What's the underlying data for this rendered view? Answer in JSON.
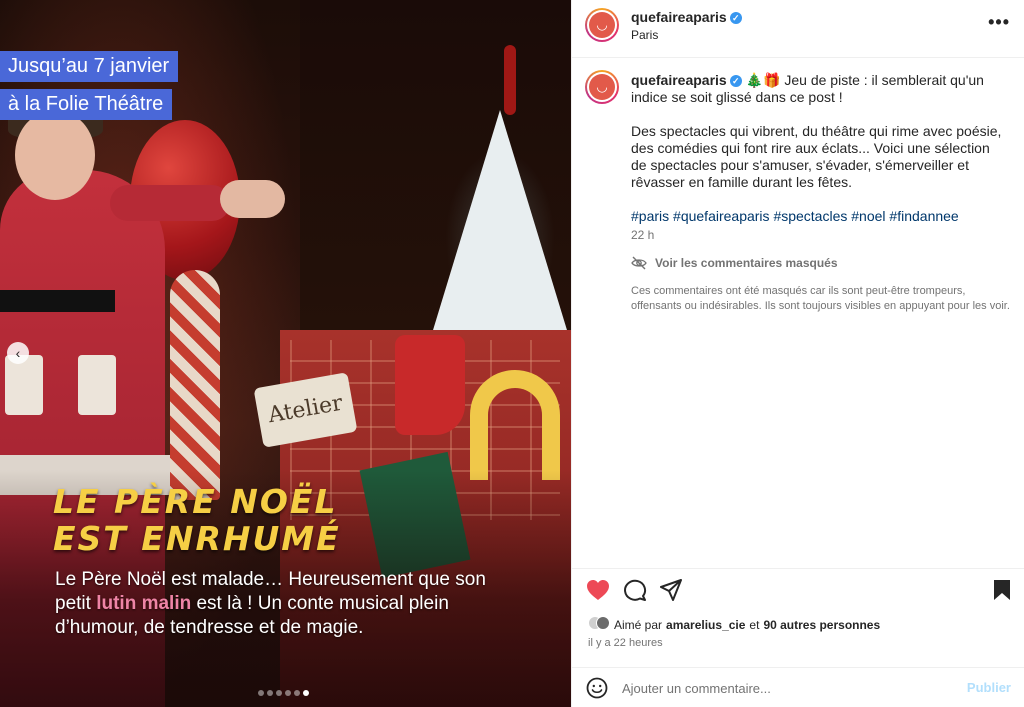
{
  "media": {
    "date_line_1": "Jusqu’au 7 janvier",
    "date_line_2": "à la Folie Théâtre",
    "headline_line_1": "LE PÈRE NOËL",
    "headline_line_2": "EST ENRHUMÉ",
    "desc_part_1": "Le Père Noël est malade… Heureusement que son petit ",
    "desc_highlight": "lutin malin",
    "desc_part_2": " est là ! Un conte musical plein d’humour, de tendresse et de magie.",
    "sign_text": "Atelier",
    "prev_icon": "‹",
    "dots_total": 6,
    "dot_active_index": 5
  },
  "header": {
    "username": "quefaireaparis",
    "location": "Paris",
    "more_icon": "•••"
  },
  "caption": {
    "username": "quefaireaparis",
    "emojis": "🎄🎁",
    "line_1": "Jeu de piste : il semblerait qu'un indice se soit glissé dans ce post !",
    "line_2": "Des spectacles qui vibrent, du théâtre qui rime avec poésie, des comédies qui font rire aux éclats... Voici une sélection de spectacles pour s'amuser, s'évader, s'émerveiller et rêvasser en famille durant les fêtes.",
    "hashtags": [
      "#paris",
      "#quefaireaparis",
      "#spectacles",
      "#noel",
      "#findannee"
    ],
    "time_ago": "22 h"
  },
  "hidden_comments": {
    "label": "Voir les commentaires masqués",
    "note": "Ces commentaires ont été masqués car ils sont peut-être trompeurs, offensants ou indésirables. Ils sont toujours visibles en appuyant pour les voir."
  },
  "likes": {
    "prefix": "Aimé par",
    "user": "amarelius_cie",
    "joiner": "et",
    "others": "90 autres personnes",
    "time_ago": "il y a 22 heures"
  },
  "comment_bar": {
    "placeholder": "Ajouter un commentaire...",
    "post_label": "Publier"
  },
  "colors": {
    "date_tag_bg": "#4a68d8",
    "headline": "#f6cf45",
    "highlight": "#ee84a6",
    "like_red": "#ed4956",
    "link": "#00376b",
    "verified": "#3897f0",
    "post_disabled": "#b2dffc"
  },
  "icons": {
    "like": "heart-icon",
    "comment": "comment-bubble-icon",
    "share": "paper-plane-icon",
    "save": "bookmark-icon",
    "emoji": "smiley-icon",
    "hidden": "eye-slash-icon",
    "verified": "verified-badge-icon",
    "prev": "chevron-left-icon"
  }
}
